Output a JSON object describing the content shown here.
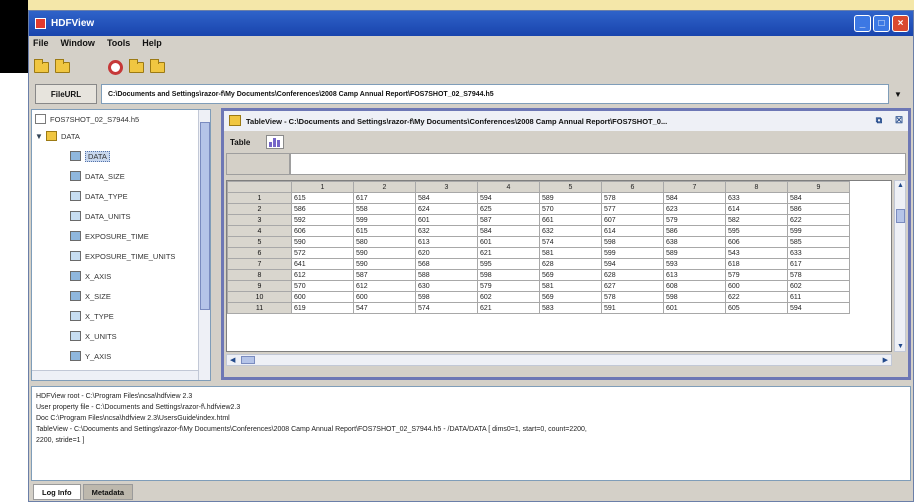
{
  "window": {
    "title": "HDFView"
  },
  "menu": [
    "File",
    "Window",
    "Tools",
    "Help"
  ],
  "toolbar_icons": [
    "open-file-icon",
    "open-folder-icon",
    "close-file-icon",
    "folder-icon",
    "folder-icon"
  ],
  "url_bar": {
    "label": "FileURL",
    "value": "C:\\Documents and Settings\\razor-f\\My Documents\\Conferences\\2008 Camp Annual Report\\FOS7SHOT_02_S7944.h5"
  },
  "tree": {
    "root": "FOS7SHOT_02_S7944.h5",
    "group": "DATA",
    "items": [
      "DATA",
      "DATA_SIZE",
      "DATA_TYPE",
      "DATA_UNITS",
      "EXPOSURE_TIME",
      "EXPOSURE_TIME_UNITS",
      "X_AXIS",
      "X_SIZE",
      "X_TYPE",
      "X_UNITS",
      "Y_AXIS"
    ]
  },
  "tableview": {
    "title": "TableView - C:\\Documents and Settings\\razor-f\\My Documents\\Conferences\\2008 Camp Annual Report\\FOS7SHOT_0...",
    "menu_label": "Table",
    "column_headers": [
      "1",
      "2",
      "3",
      "4",
      "5",
      "6",
      "7",
      "8",
      "9"
    ],
    "rows": [
      {
        "n": "1",
        "v": [
          "615",
          "617",
          "584",
          "594",
          "589",
          "578",
          "584",
          "633",
          "584"
        ]
      },
      {
        "n": "2",
        "v": [
          "586",
          "558",
          "624",
          "625",
          "570",
          "577",
          "623",
          "614",
          "586"
        ]
      },
      {
        "n": "3",
        "v": [
          "592",
          "599",
          "601",
          "587",
          "661",
          "607",
          "579",
          "582",
          "622"
        ]
      },
      {
        "n": "4",
        "v": [
          "606",
          "615",
          "632",
          "584",
          "632",
          "614",
          "586",
          "595",
          "599"
        ]
      },
      {
        "n": "5",
        "v": [
          "590",
          "580",
          "613",
          "601",
          "574",
          "598",
          "638",
          "606",
          "585"
        ]
      },
      {
        "n": "6",
        "v": [
          "572",
          "590",
          "620",
          "621",
          "581",
          "599",
          "589",
          "543",
          "633"
        ]
      },
      {
        "n": "7",
        "v": [
          "641",
          "590",
          "568",
          "595",
          "628",
          "594",
          "593",
          "618",
          "617"
        ]
      },
      {
        "n": "8",
        "v": [
          "612",
          "587",
          "588",
          "598",
          "569",
          "628",
          "613",
          "579",
          "578"
        ]
      },
      {
        "n": "9",
        "v": [
          "570",
          "612",
          "630",
          "579",
          "581",
          "627",
          "608",
          "600",
          "602"
        ]
      },
      {
        "n": "10",
        "v": [
          "600",
          "600",
          "598",
          "602",
          "569",
          "578",
          "598",
          "622",
          "611"
        ]
      },
      {
        "n": "11",
        "v": [
          "619",
          "547",
          "574",
          "621",
          "583",
          "591",
          "601",
          "605",
          "594"
        ]
      }
    ]
  },
  "log": [
    "HDFView root - C:\\Program Files\\ncsa\\hdfview 2.3",
    "User property file - C:\\Documents and Settings\\razor-f\\.hdfview2.3",
    "Doc C:\\Program Files\\ncsa\\hdfview 2.3\\UsersGuide\\index.html",
    "TableView - C:\\Documents and Settings\\razor-f\\My Documents\\Conferences\\2008 Camp Annual Report\\FOS7SHOT_02_S7944.h5 - /DATA/DATA [ dims0=1, start=0, count=2200,",
    "2200, stride=1 ]"
  ],
  "tabs": [
    "Log Info",
    "Metadata"
  ]
}
